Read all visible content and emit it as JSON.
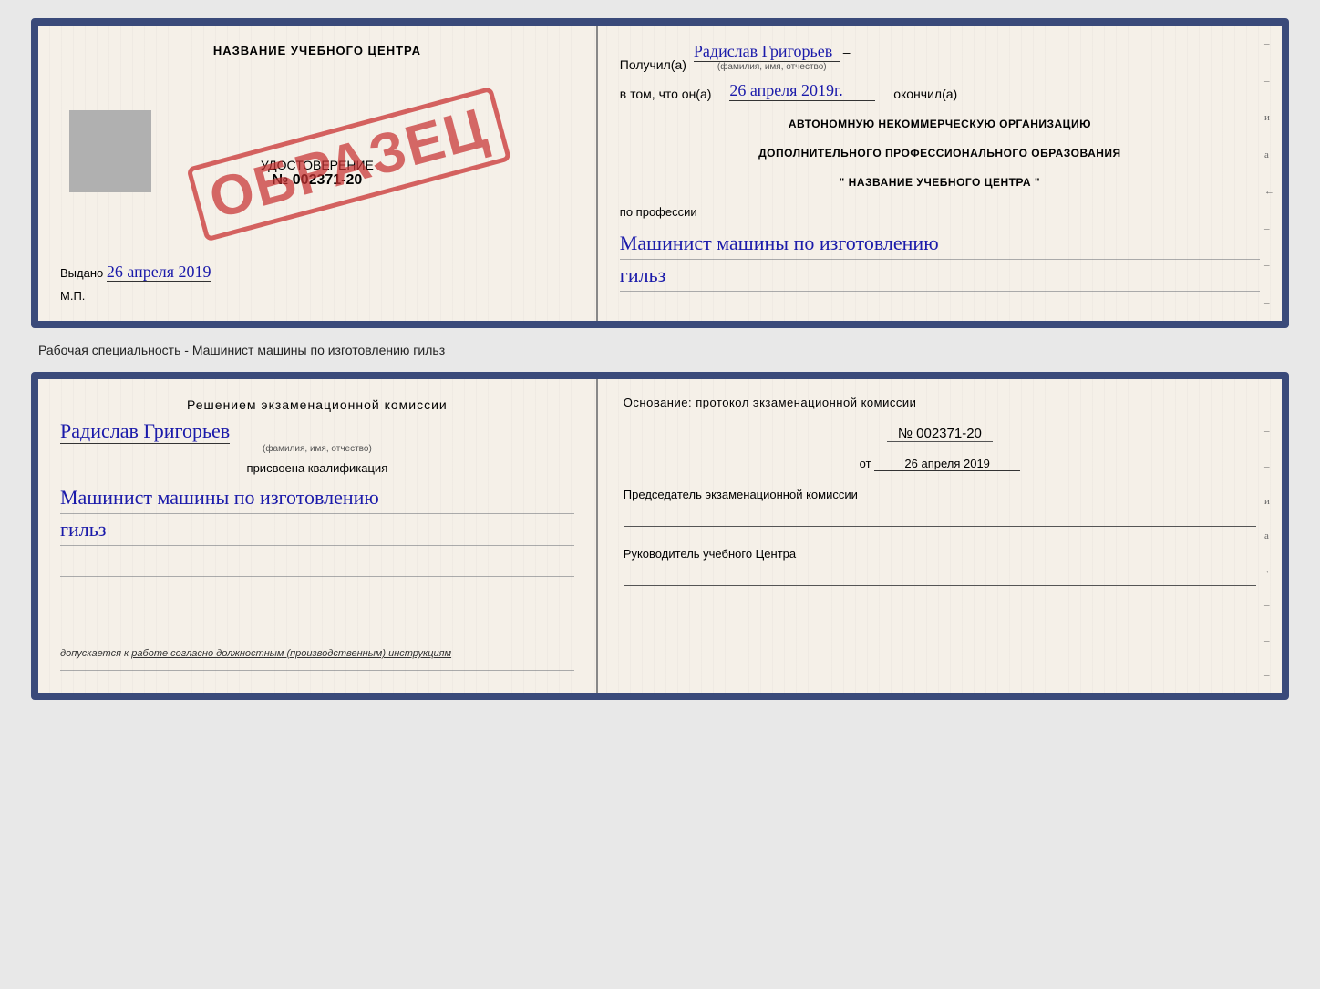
{
  "top_cert": {
    "left": {
      "title": "НАЗВАНИЕ УЧЕБНОГО ЦЕНТРА",
      "cert_label": "УДОСТОВЕРЕНИЕ",
      "cert_number": "№ 002371-20",
      "obrazets": "ОБРАЗЕЦ",
      "issued_label": "Выдано",
      "issued_date": "26 апреля 2019",
      "mp_label": "М.П."
    },
    "right": {
      "received_label": "Получил(а)",
      "recipient_name": "Радислав Григорьев",
      "fio_subtext": "(фамилия, имя, отчество)",
      "in_that_label": "в том, что он(а)",
      "date_value": "26 апреля 2019г.",
      "finished_label": "окончил(а)",
      "org_line1": "АВТОНОМНУЮ НЕКОММЕРЧЕСКУЮ ОРГАНИЗАЦИЮ",
      "org_line2": "ДОПОЛНИТЕЛЬНОГО ПРОФЕССИОНАЛЬНОГО ОБРАЗОВАНИЯ",
      "org_name": "\"  НАЗВАНИЕ УЧЕБНОГО ЦЕНТРА  \"",
      "profession_label": "по профессии",
      "profession_value": "Машинист машины по изготовлению",
      "profession_value2": "гильз"
    },
    "right_marks": [
      "–",
      "–",
      "и",
      "а",
      "←",
      "–",
      "–",
      "–"
    ]
  },
  "separator": {
    "label": "Рабочая специальность - Машинист машины по изготовлению гильз"
  },
  "bottom_cert": {
    "left": {
      "decision_title": "Решением  экзаменационной  комиссии",
      "person_name": "Радислав Григорьев",
      "fio_subtext": "(фамилия, имя, отчество)",
      "assigned_label": "присвоена квалификация",
      "qualification_value": "Машинист машины по изготовлению",
      "qualification_value2": "гильз",
      "allowed_prefix": "допускается к",
      "allowed_text": "работе согласно должностным (производственным) инструкциям"
    },
    "right": {
      "basis_label": "Основание: протокол экзаменационной комиссии",
      "protocol_number": "№  002371-20",
      "date_prefix": "от",
      "date_value": "26 апреля 2019",
      "chairman_label": "Председатель экзаменационной комиссии",
      "director_label": "Руководитель учебного Центра"
    },
    "right_marks": [
      "–",
      "–",
      "–",
      "и",
      "а",
      "←",
      "–",
      "–",
      "–"
    ]
  }
}
